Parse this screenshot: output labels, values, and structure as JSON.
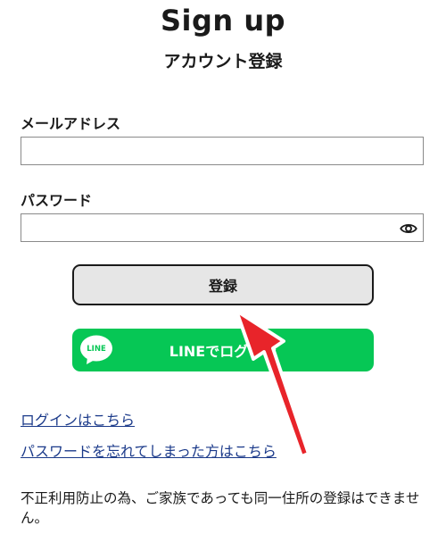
{
  "header": {
    "title": "Sign up",
    "subtitle": "アカウント登録"
  },
  "form": {
    "email_label": "メールアドレス",
    "email_value": "",
    "password_label": "パスワード",
    "password_value": "",
    "toggle_icon": "eye-icon"
  },
  "buttons": {
    "register_label": "登録",
    "line_label": "LINEでログイン",
    "line_logo_text": "LINE",
    "line_color": "#06c755"
  },
  "links": {
    "login": "ログインはこちら",
    "forgot_password": "パスワードを忘れてしまった方はこちら"
  },
  "notice": "不正利用防止の為、ご家族であっても同一住所の登録はできません。",
  "annotation": {
    "arrow_color": "#e8242a"
  }
}
